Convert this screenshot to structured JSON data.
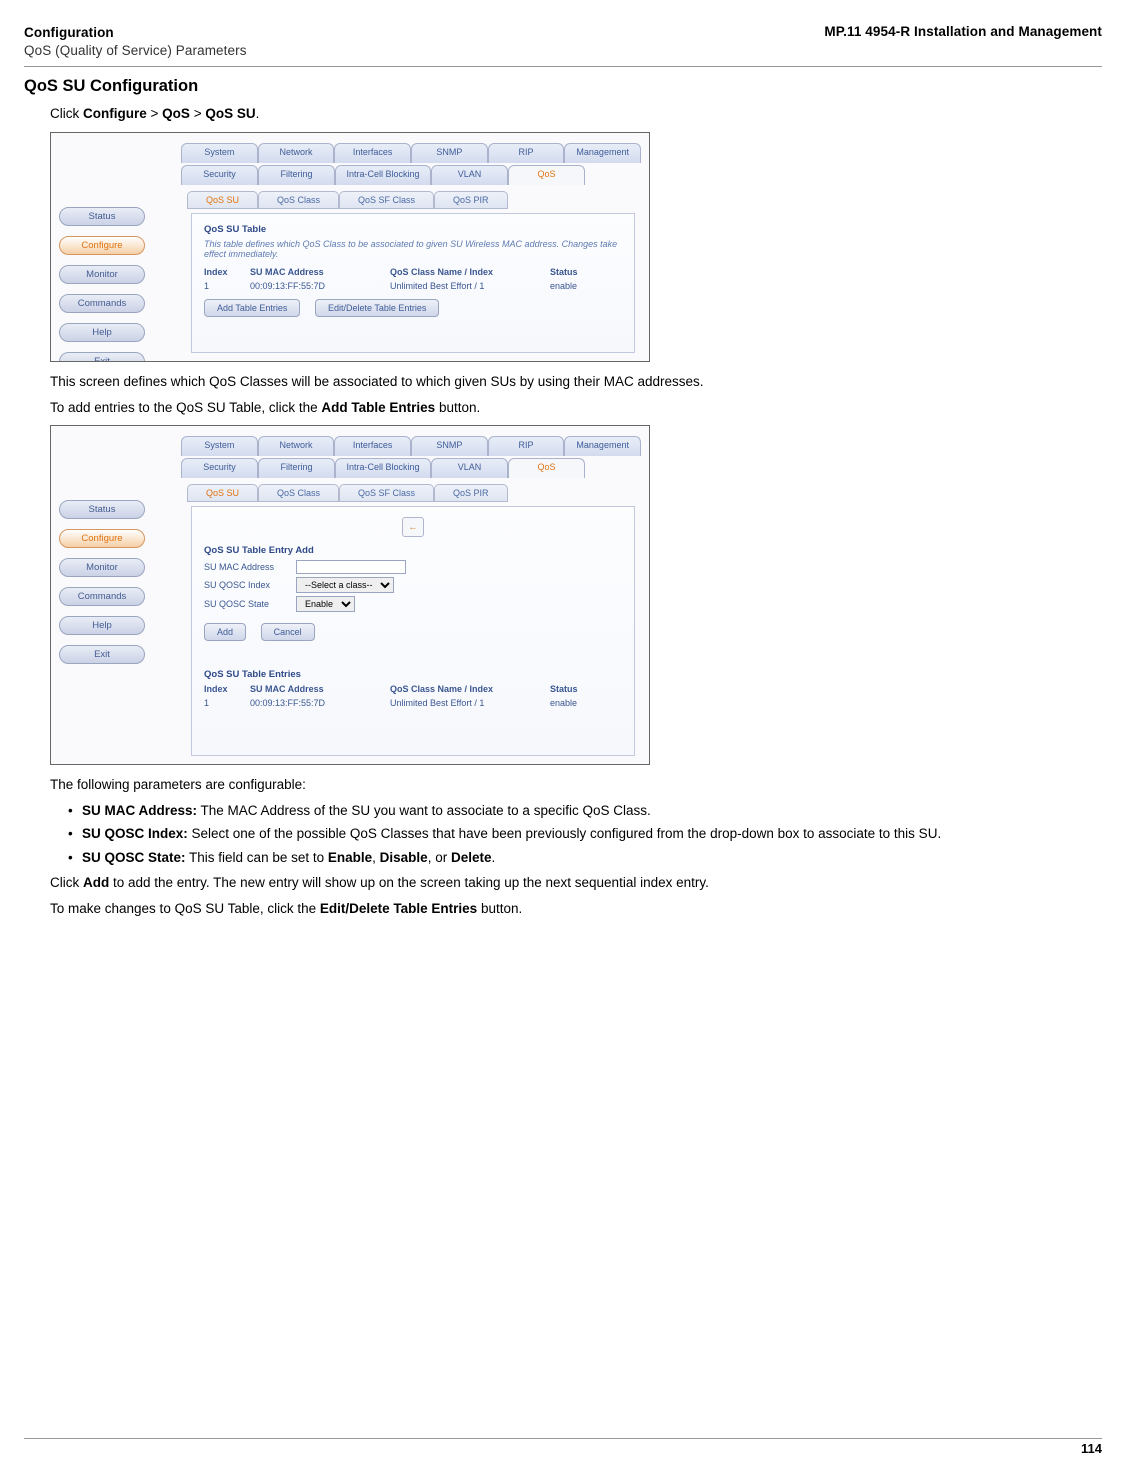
{
  "header": {
    "left_line1": "Configuration",
    "left_line2": "QoS (Quality of Service) Parameters",
    "right": "MP.11 4954-R Installation and Management"
  },
  "heading": "QoS SU Configuration",
  "intro": {
    "prefix": "Click ",
    "b1": "Configure",
    "sep": " > ",
    "b2": "QoS",
    "b3": "QoS SU",
    "dot": "."
  },
  "tabs_top": [
    "System",
    "Network",
    "Interfaces",
    "SNMP",
    "RIP",
    "Management"
  ],
  "tabs_bot": [
    "Security",
    "Filtering",
    "Intra-Cell Blocking",
    "VLAN",
    "QoS"
  ],
  "subtabs": [
    "QoS SU",
    "QoS Class",
    "QoS SF Class",
    "QoS PIR"
  ],
  "side": [
    "Status",
    "Configure",
    "Monitor",
    "Commands",
    "Help",
    "Exit"
  ],
  "panel1": {
    "title": "QoS SU Table",
    "italic": "This table defines which QoS Class to be associated to given SU Wireless MAC address. Changes take effect immediately.",
    "hdr": {
      "c1": "Index",
      "c2": "SU MAC Address",
      "c3": "QoS Class Name / Index",
      "c4": "Status"
    },
    "row": {
      "c1": "1",
      "c2": "00:09:13:FF:55:7D",
      "c3": "Unlimited Best Effort / 1",
      "c4": "enable"
    },
    "btn1": "Add Table Entries",
    "btn2": "Edit/Delete Table Entries"
  },
  "mid_p1": "This screen defines which QoS Classes will be associated to which given SUs by using their MAC addresses.",
  "mid_p2_a": "To add entries to the QoS SU Table, click the ",
  "mid_p2_b": "Add Table Entries",
  "mid_p2_c": " button.",
  "panel2": {
    "title1": "QoS SU Table Entry Add",
    "f1": "SU MAC Address",
    "f2": "SU QOSC Index",
    "f2v": "--Select a class--",
    "f3": "SU QOSC State",
    "f3v": "Enable",
    "add": "Add",
    "cancel": "Cancel",
    "title2": "QoS SU Table Entries"
  },
  "after": {
    "p1": "The following parameters are configurable:",
    "b1_t": "SU MAC Address:",
    "b1_r": " The MAC Address of the SU you want to associate to a specific QoS Class.",
    "b2_t": "SU QOSC Index:",
    "b2_r": " Select one of the possible QoS Classes that have been previously configured from the drop-down box to associate to this SU.",
    "b3_t": "SU QOSC State:",
    "b3_r_a": " This field can be set to ",
    "b3_e": "Enable",
    "b3_c": ", ",
    "b3_d": "Disable",
    "b3_o": ", or ",
    "b3_del": "Delete",
    "b3_dot": ".",
    "p2_a": "Click ",
    "p2_b": "Add",
    "p2_c": " to add the entry. The new entry will show up on the screen taking up the next sequential index entry.",
    "p3_a": "To make changes to QoS SU Table, click the ",
    "p3_b": "Edit/Delete Table Entries",
    "p3_c": " button."
  },
  "page": "114"
}
